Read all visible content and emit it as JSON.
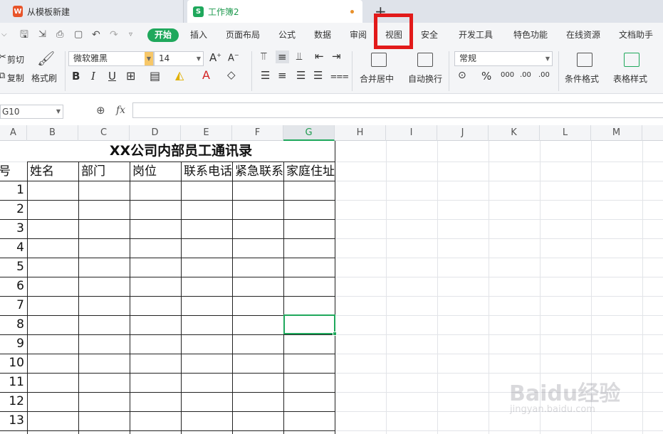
{
  "tabs": [
    {
      "label": "从模板新建",
      "icon": "wps-icon"
    },
    {
      "label": "工作簿2",
      "icon": "spreadsheet-icon",
      "unsaved": true
    }
  ],
  "menu": [
    "开始",
    "插入",
    "页面布局",
    "公式",
    "数据",
    "审阅",
    "视图",
    "安全",
    "开发工具",
    "特色功能",
    "在线资源",
    "文档助手"
  ],
  "menu_active": "开始",
  "menu_highlighted": "视图",
  "ribbon": {
    "cut": "剪切",
    "copy": "复制",
    "format_painter": "格式刷",
    "font_name": "微软雅黑",
    "font_size": "14",
    "bold": "B",
    "italic": "I",
    "underline": "U",
    "merge_center": "合并居中",
    "wrap_text": "自动换行",
    "number_format": "常规",
    "conditional_format": "条件格式",
    "table_style": "表格样式"
  },
  "formula_bar": {
    "name_box": "G10",
    "fx": "fx",
    "value": ""
  },
  "columns": [
    "A",
    "B",
    "C",
    "D",
    "E",
    "F",
    "G",
    "H",
    "I",
    "J",
    "K",
    "L",
    "M"
  ],
  "selected_column": "G",
  "table": {
    "title": "XX公司内部员工通讯录",
    "headers": [
      "号",
      "姓名",
      "部门",
      "岗位",
      "联系电话",
      "紧急联系人",
      "家庭住址"
    ],
    "row_numbers": [
      "1",
      "2",
      "3",
      "4",
      "5",
      "6",
      "7",
      "8",
      "9",
      "10",
      "11",
      "12",
      "13"
    ]
  },
  "watermark": {
    "logo": "Baidu经验",
    "url": "jingyan.baidu.com"
  },
  "colors": {
    "accent": "#1fa85c",
    "highlight_box": "#e21a1a"
  }
}
